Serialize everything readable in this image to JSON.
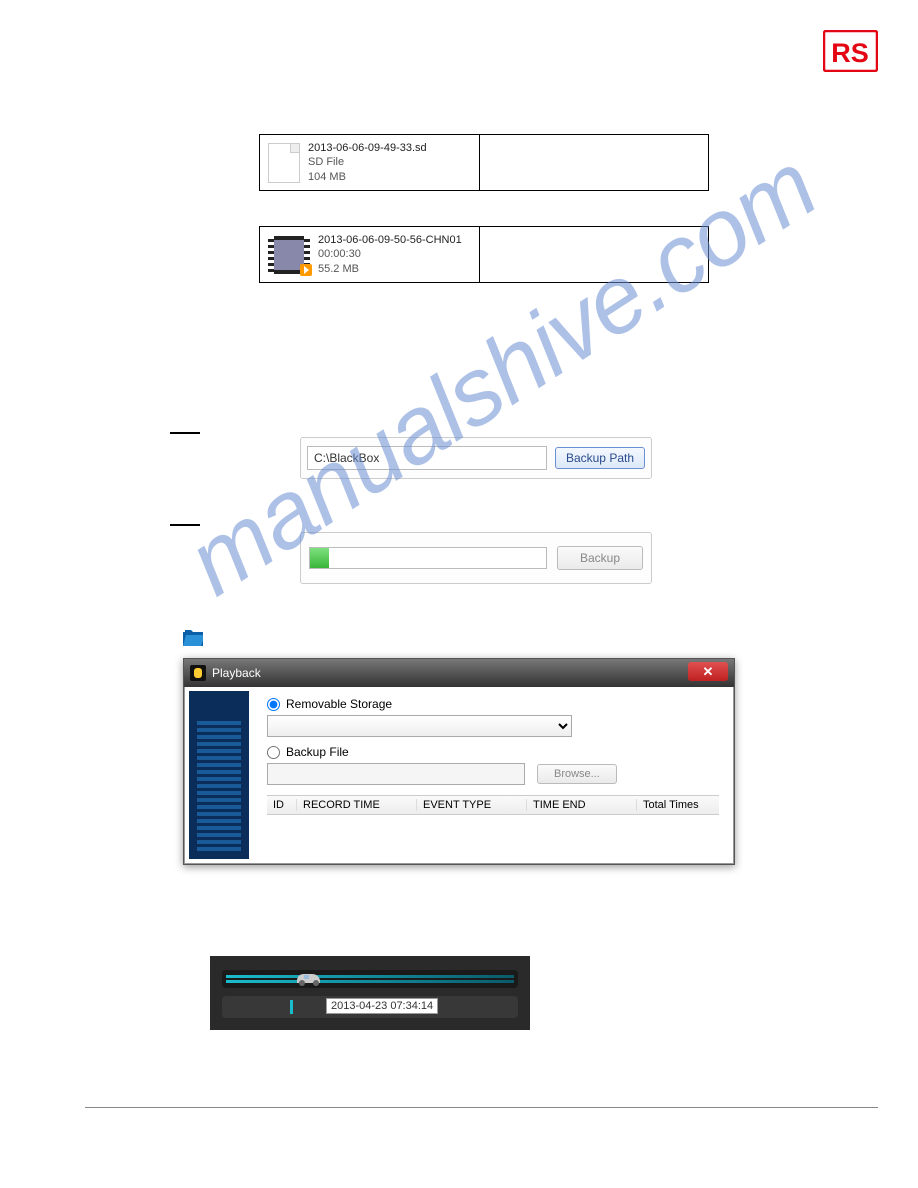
{
  "logo": {
    "name": "RS"
  },
  "watermark": "manualshive.com",
  "file1": {
    "name": "2013-06-06-09-49-33.sd",
    "type": "SD File",
    "size": "104 MB"
  },
  "file2": {
    "name": "2013-06-06-09-50-56-CHN01",
    "duration": "00:00:30",
    "size": "55.2 MB"
  },
  "backup_path": {
    "value": "C:\\BlackBox",
    "button": "Backup Path"
  },
  "backup": {
    "button": "Backup"
  },
  "dialog": {
    "title": "Playback",
    "removable": "Removable Storage",
    "backup_file": "Backup File",
    "browse": "Browse...",
    "cols": {
      "id": "ID",
      "rt": "RECORD TIME",
      "et": "EVENT TYPE",
      "te": "TIME END",
      "tt": "Total Times"
    }
  },
  "speed": {
    "timestamp": "2013-04-23 07:34:14"
  }
}
